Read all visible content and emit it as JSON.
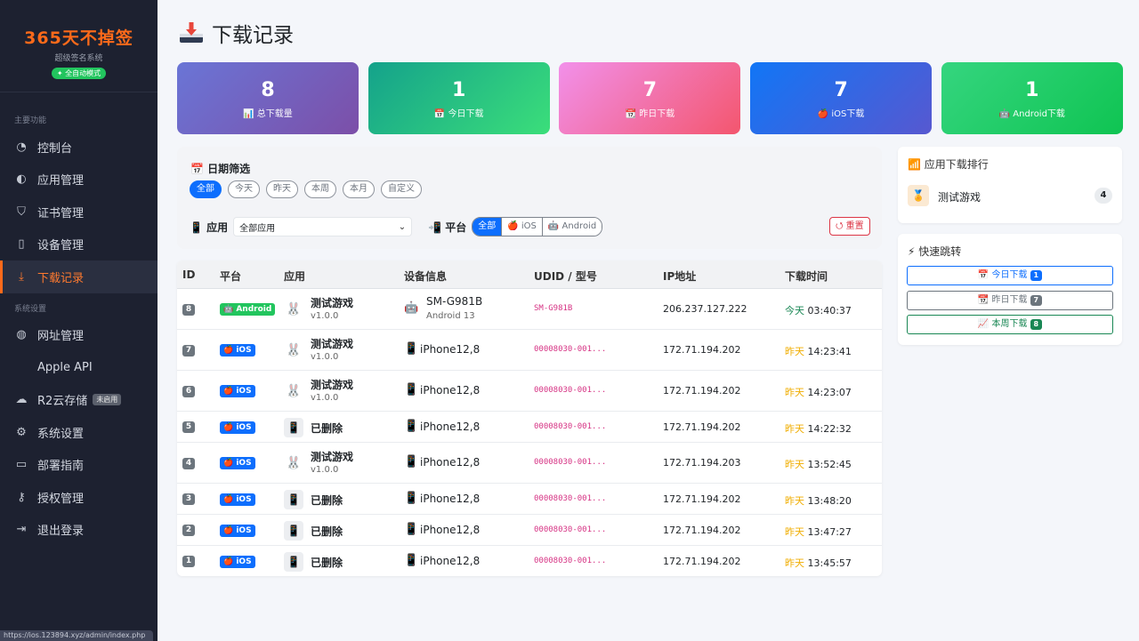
{
  "brand": {
    "title": "365天不掉签",
    "subtitle": "超级签名系统",
    "badge": "✦ 全自动模式"
  },
  "sidebar": {
    "section_main": "主要功能",
    "section_settings": "系统设置",
    "items": [
      {
        "label": "控制台",
        "icon": "dashboard-icon",
        "glyph": "◔"
      },
      {
        "label": "应用管理",
        "icon": "app-icon",
        "glyph": "◐"
      },
      {
        "label": "证书管理",
        "icon": "shield-icon",
        "glyph": "⛉"
      },
      {
        "label": "设备管理",
        "icon": "phone-icon",
        "glyph": "▯"
      },
      {
        "label": "下载记录",
        "icon": "download-icon",
        "glyph": "⤓"
      }
    ],
    "settings_items": [
      {
        "label": "网址管理",
        "icon": "globe-icon",
        "glyph": "◍"
      },
      {
        "label": "Apple API",
        "icon": "apple-icon",
        "glyph": ""
      },
      {
        "label": "R2云存储",
        "icon": "cloud-icon",
        "glyph": "☁",
        "tag": "未启用"
      },
      {
        "label": "系统设置",
        "icon": "gear-icon",
        "glyph": "⚙"
      },
      {
        "label": "部署指南",
        "icon": "book-icon",
        "glyph": "▭"
      },
      {
        "label": "授权管理",
        "icon": "key-icon",
        "glyph": "⚷"
      },
      {
        "label": "退出登录",
        "icon": "logout-icon",
        "glyph": "⇥"
      }
    ],
    "status_url": "https://ios.123894.xyz/admin/index.php"
  },
  "page": {
    "title": "下载记录"
  },
  "stats": [
    {
      "value": "8",
      "label": "📊 总下载量",
      "from": "#6a75d6",
      "to": "#7c4fa8"
    },
    {
      "value": "1",
      "label": "📅 今日下载",
      "from": "#14a28b",
      "to": "#3bde7a"
    },
    {
      "value": "7",
      "label": "📆 昨日下载",
      "from": "#f290ea",
      "to": "#f3566e"
    },
    {
      "value": "7",
      "label": "🍎 iOS下载",
      "from": "#1176f6",
      "to": "#5758d0"
    },
    {
      "value": "1",
      "label": "🤖 Android下载",
      "from": "#35d57f",
      "to": "#0fc452"
    }
  ],
  "filter": {
    "title": "📅 日期筛选",
    "chips": [
      "全部",
      "今天",
      "昨天",
      "本周",
      "本月",
      "自定义"
    ],
    "app_label": "📱 应用",
    "app_select": "全部应用",
    "platform_label": "📲 平台",
    "platform_opts": [
      "全部",
      "🍎 iOS",
      "🤖 Android"
    ],
    "reset": "⭯ 重置"
  },
  "table": {
    "headers": [
      "ID",
      "平台",
      "应用",
      "设备信息",
      "UDID / 型号",
      "IP地址",
      "下载时间"
    ],
    "rows": [
      {
        "id": "8",
        "platform": "🤖 Android",
        "app": "测试游戏",
        "ver": "v1.0.0",
        "device": "SM-G981B",
        "device_sub": "Android 13",
        "udid": "SM-G981B",
        "ip": "206.237.127.222",
        "day": "今天",
        "time": "03:40:37"
      },
      {
        "id": "7",
        "platform": "🍎 iOS",
        "app": "测试游戏",
        "ver": "v1.0.0",
        "device": "iPhone12,8",
        "udid": "00008030-001...",
        "ip": "172.71.194.202",
        "day": "昨天",
        "time": "14:23:41"
      },
      {
        "id": "6",
        "platform": "🍎 iOS",
        "app": "测试游戏",
        "ver": "v1.0.0",
        "device": "iPhone12,8",
        "udid": "00008030-001...",
        "ip": "172.71.194.202",
        "day": "昨天",
        "time": "14:23:07"
      },
      {
        "id": "5",
        "platform": "🍎 iOS",
        "app": "已删除",
        "device": "iPhone12,8",
        "udid": "00008030-001...",
        "ip": "172.71.194.202",
        "day": "昨天",
        "time": "14:22:32"
      },
      {
        "id": "4",
        "platform": "🍎 iOS",
        "app": "测试游戏",
        "ver": "v1.0.0",
        "device": "iPhone12,8",
        "udid": "00008030-001...",
        "ip": "172.71.194.203",
        "day": "昨天",
        "time": "13:52:45"
      },
      {
        "id": "3",
        "platform": "🍎 iOS",
        "app": "已删除",
        "device": "iPhone12,8",
        "udid": "00008030-001...",
        "ip": "172.71.194.202",
        "day": "昨天",
        "time": "13:48:20"
      },
      {
        "id": "2",
        "platform": "🍎 iOS",
        "app": "已删除",
        "device": "iPhone12,8",
        "udid": "00008030-001...",
        "ip": "172.71.194.202",
        "day": "昨天",
        "time": "13:47:27"
      },
      {
        "id": "1",
        "platform": "🍎 iOS",
        "app": "已删除",
        "device": "iPhone12,8",
        "udid": "00008030-001...",
        "ip": "172.71.194.202",
        "day": "昨天",
        "time": "13:45:57"
      }
    ]
  },
  "ranking": {
    "title": "📶 应用下载排行",
    "items": [
      {
        "name": "测试游戏",
        "count": "4"
      }
    ]
  },
  "quickjump": {
    "title": "⚡ 快速跳转",
    "buttons": [
      {
        "label": "📅 今日下载",
        "count": "1",
        "color": "#0d6efd"
      },
      {
        "label": "📆 昨日下载",
        "count": "7",
        "color": "#6c757d"
      },
      {
        "label": "📈 本周下载",
        "count": "8",
        "color": "#198754"
      }
    ]
  }
}
